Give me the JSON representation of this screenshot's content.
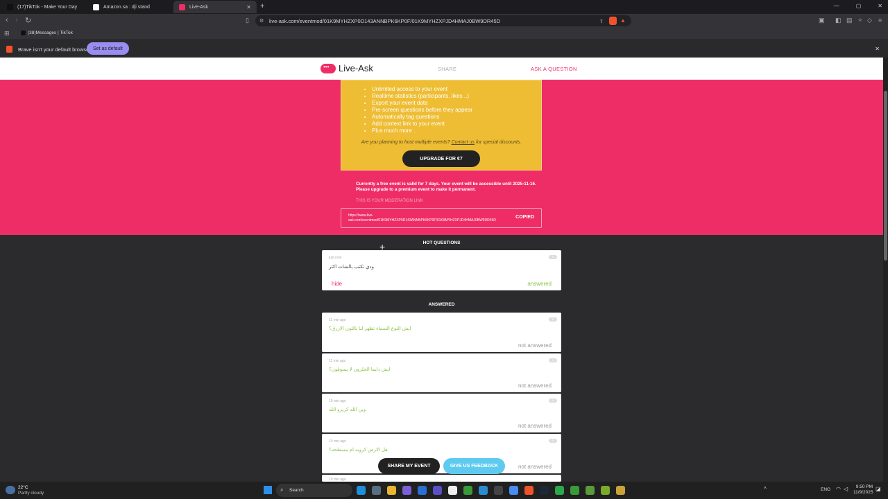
{
  "browser": {
    "tabs": [
      {
        "label": "(17)TikTok - Make Your Day"
      },
      {
        "label": "Amazon.sa : dji stand"
      },
      {
        "label": "Live-Ask"
      }
    ],
    "url": "live-ask.com/eventmod/01K9MYHZXP0D143ANNBPK6KP0F/01K9MYHZXPJD4HMAJ0BW9DR45D",
    "bookmark": "(38)Messages | TikTok",
    "info_text": "Brave isn't your default browser",
    "set_default_label": "Set as default"
  },
  "app": {
    "logo": "Live-Ask",
    "nav_share": "SHARE",
    "nav_ask": "ASK A QUESTION",
    "features": [
      "Unlimited access to your event",
      "Realtime statistics (participants, likes ..)",
      "Export your event data",
      "Pre-screen questions before they appear",
      "Automatically tag questions",
      "Add context link to your event",
      "Plus much more .."
    ],
    "plan_text_a": "Are you planning to host multiple events? ",
    "plan_link": "Contact us",
    "plan_text_b": " for special discounts.",
    "upgrade_label": "UPGRADE FOR €7",
    "valid_line1": "Currently a free event is valid for 7 days. Your event will be accessible until 2025-11-16.",
    "valid_line2": "Please upgrade to a premium event to make it permanent.",
    "mod_label": "THIS IS YOUR MODERATION LINK",
    "mod_link": "https://www.live-ask.com/eventmod/01K9MYHZXP0D143ANNBPK6KP0F/01K9MYHZXPJD4HMAJ0BW9DR45D",
    "copied_label": "COPIED",
    "hot_title": "HOT QUESTIONS",
    "hot": {
      "time": "just now",
      "count": "0",
      "text": "ودي تكتب بالشات اكثر",
      "hide": "hide",
      "status": "answered"
    },
    "answered_title": "ANSWERED",
    "answered": [
      {
        "time": "11 min ago",
        "count": "0",
        "text": "ايش النوع السماء تظهر لنا باللون الازرق؟",
        "status": "not answered"
      },
      {
        "time": "11 min ago",
        "count": "0",
        "text": "ايش دايما الحلزون لا يسوقون؟",
        "status": "not answered"
      },
      {
        "time": "10 min ago",
        "count": "0",
        "text": "وين الله كريزو الله",
        "status": "not answered"
      },
      {
        "time": "10 min ago",
        "count": "0",
        "text": "هل الارض كرويه ام مسطحه؟",
        "status": "not answered"
      }
    ],
    "next_time": "10 min ago",
    "share_event": "SHARE MY EVENT",
    "feedback": "GIVE US FEEDBACK"
  },
  "taskbar": {
    "temp": "22°C",
    "weather": "Partly cloudy",
    "search": "Search",
    "lang": "ENG",
    "time": "9:50 PM",
    "date": "11/9/2025"
  },
  "colors": {
    "brand": "#ee2d67",
    "yellow": "#eebd34",
    "answered": "#8bc34a",
    "feedback": "#5ecaf0"
  }
}
